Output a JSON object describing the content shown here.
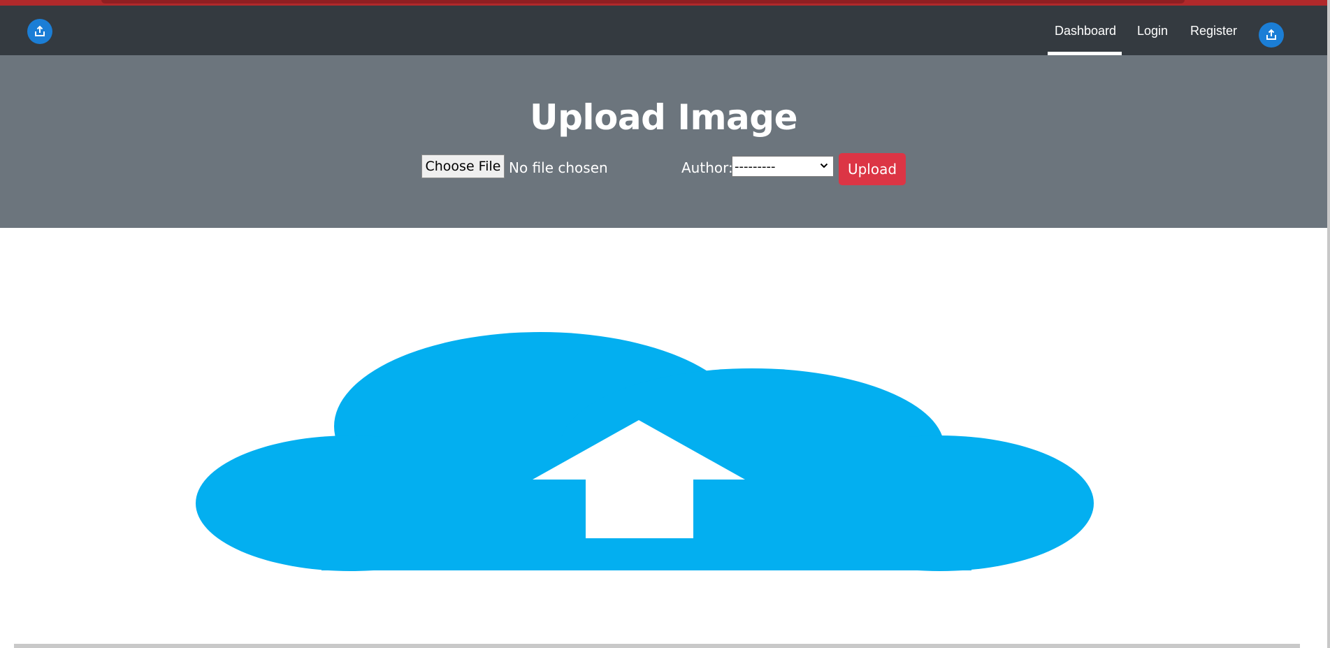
{
  "navbar": {
    "left_button_icon": "upload-share-icon",
    "right_button_icon": "upload-share-icon",
    "links": [
      {
        "label": "Dashboard",
        "active": true
      },
      {
        "label": "Login",
        "active": false
      },
      {
        "label": "Register",
        "active": false
      }
    ]
  },
  "hero": {
    "title": "Upload Image",
    "file_button_label": "Choose File",
    "file_status": "No file chosen",
    "author_label": "Author:",
    "author_selected": "---------",
    "upload_button_label": "Upload"
  },
  "illustration": {
    "icon": "cloud-upload-icon",
    "cloud_color": "#03aff0",
    "arrow_color": "#ffffff"
  },
  "colors": {
    "navbar_bg": "#343a40",
    "hero_bg": "#6c757d",
    "accent_button": "#dc3545",
    "round_button": "#1b7ed6"
  }
}
